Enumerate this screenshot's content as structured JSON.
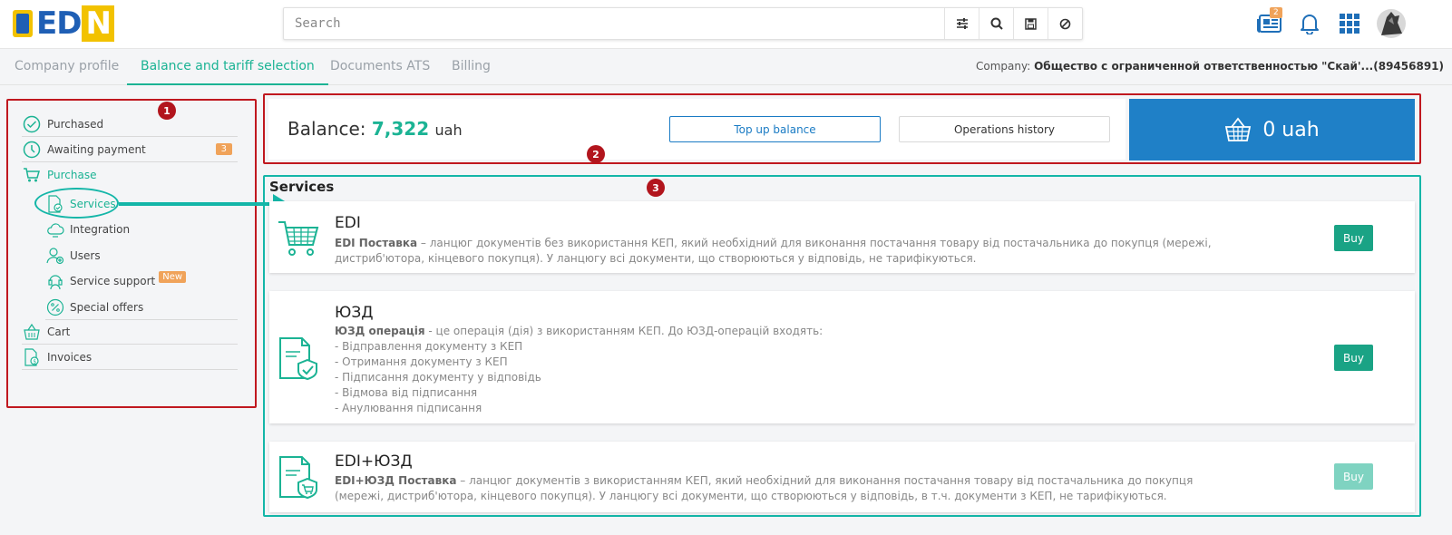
{
  "header": {
    "brand": {
      "e": "E",
      "d": "D",
      "n": "N"
    },
    "search": {
      "placeholder": "Search"
    },
    "news_badge": "2"
  },
  "tabs": [
    {
      "label": "Company profile",
      "active": false
    },
    {
      "label": "Balance and tariff selection",
      "active": true
    },
    {
      "label": "Documents ATS",
      "active": false
    },
    {
      "label": "Billing",
      "active": false
    }
  ],
  "company": {
    "label": "Company:",
    "name": "Общество с ограниченной ответственностью \"Скай'...(89456891)"
  },
  "annotations": {
    "n1": "1",
    "n2": "2",
    "n3": "3"
  },
  "sidebar": {
    "purchased": "Purchased",
    "awaiting": "Awaiting payment",
    "awaiting_count": "3",
    "purchase": "Purchase",
    "services": "Services",
    "integration": "Integration",
    "users": "Users",
    "support": "Service support",
    "new_badge": "New",
    "offers": "Special offers",
    "cart": "Cart",
    "invoices": "Invoices"
  },
  "balance": {
    "label": "Balance:",
    "value": "7,322",
    "currency": "uah",
    "topup": "Top up balance",
    "history": "Operations history",
    "cart_total": "0 uah"
  },
  "services": {
    "title": "Services",
    "items": [
      {
        "title": "EDI",
        "lead": "EDI Поставка",
        "text": " – ланцюг документів без використання КЕП, який необхідний для виконання постачання товару від постачальника до покупця (мережі, дистриб'ютора, кінцевого покупця). У ланцюгу всі документи, що створюються у відповідь, не тарифікуються.",
        "buy": "Buy"
      },
      {
        "title": "ЮЗД",
        "lead": "ЮЗД операція",
        "text": " - це операція (дія) з використанням КЕП. До ЮЗД-операцій входять:",
        "list": [
          "- Відправлення документу з КЕП",
          "- Отримання документу з КЕП",
          "- Підписання документу у відповідь",
          "- Відмова від підписання",
          "- Анулювання підписання"
        ],
        "buy": "Buy"
      },
      {
        "title": "EDI+ЮЗД",
        "lead": "EDI+ЮЗД Поставка",
        "text": " – ланцюг документів з використанням КЕП, який необхідний для виконання постачання товару від постачальника до покупця (мережі, дистриб'ютора, кінцевого покупця). У ланцюгу всі документи, що створюються у відповідь, в т.ч. документи з КЕП, не тарифікуються.",
        "buy": "Buy"
      }
    ]
  },
  "colors": {
    "accent": "#1bb394",
    "blue": "#1f80c7",
    "annotation_red": "#c0181f",
    "annotation_teal": "#14b6a8",
    "badge": "#f0a35a"
  }
}
